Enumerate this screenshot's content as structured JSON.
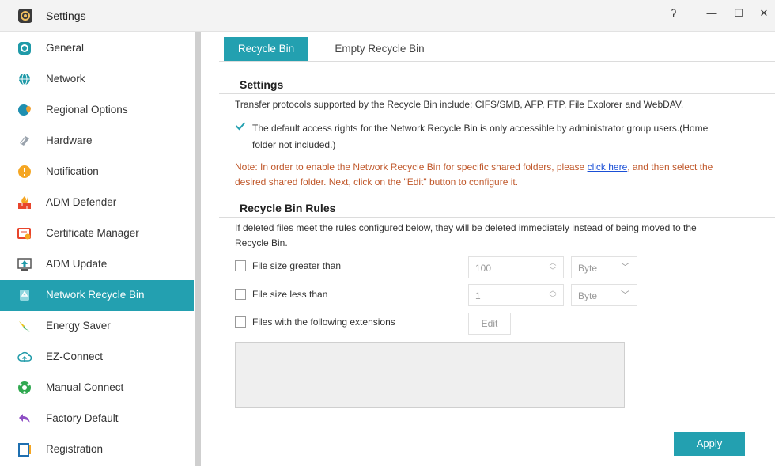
{
  "window": {
    "title": "Settings",
    "help_glyph": "ʔ",
    "min_glyph": "—",
    "max_glyph": "☐",
    "close_glyph": "✕"
  },
  "sidebar": {
    "items": [
      {
        "label": "General",
        "icon": "general-icon"
      },
      {
        "label": "Network",
        "icon": "globe-icon"
      },
      {
        "label": "Regional Options",
        "icon": "regional-icon"
      },
      {
        "label": "Hardware",
        "icon": "hardware-icon"
      },
      {
        "label": "Notification",
        "icon": "notification-icon"
      },
      {
        "label": "ADM Defender",
        "icon": "firewall-icon"
      },
      {
        "label": "Certificate Manager",
        "icon": "certificate-icon"
      },
      {
        "label": "ADM Update",
        "icon": "update-icon"
      },
      {
        "label": "Network Recycle Bin",
        "icon": "recycle-icon"
      },
      {
        "label": "Energy Saver",
        "icon": "energy-icon"
      },
      {
        "label": "EZ-Connect",
        "icon": "cloud-upload-icon"
      },
      {
        "label": "Manual Connect",
        "icon": "manual-connect-icon"
      },
      {
        "label": "Factory Default",
        "icon": "reset-icon"
      },
      {
        "label": "Registration",
        "icon": "registration-icon"
      }
    ],
    "active_index": 8
  },
  "tabs": {
    "recycle_bin": "Recycle Bin",
    "empty_recycle_bin": "Empty Recycle Bin"
  },
  "settings": {
    "heading": "Settings",
    "protocols_text": "Transfer protocols supported by the Recycle Bin include: CIFS/SMB, AFP, FTP, File Explorer and WebDAV.",
    "admin_only_line1": "The default access rights for the Network Recycle Bin is only accessible by administrator group users.(Home",
    "admin_only_line2": "folder not included.)",
    "admin_only_checked": true,
    "note_prefix": "Note: In order to enable the Network Recycle Bin for specific shared folders, please ",
    "note_link": "click here",
    "note_suffix": ", and then select the",
    "note_line2": "desired shared folder. Next, click on the \"Edit\" button to configure it."
  },
  "rules": {
    "heading": "Recycle Bin Rules",
    "desc_line1": "If deleted files meet the rules configured below, they will be deleted immediately instead of being moved to the",
    "desc_line2": "Recycle Bin.",
    "size_greater_label": "File size greater than",
    "size_greater_value": "100",
    "size_greater_unit": "Byte",
    "size_less_label": "File size less than",
    "size_less_value": "1",
    "size_less_unit": "Byte",
    "extensions_label": "Files with the following extensions",
    "edit_label": "Edit"
  },
  "apply_label": "Apply",
  "colors": {
    "accent": "#23a0b0",
    "note": "#c0582b",
    "link": "#1a4fd6"
  }
}
